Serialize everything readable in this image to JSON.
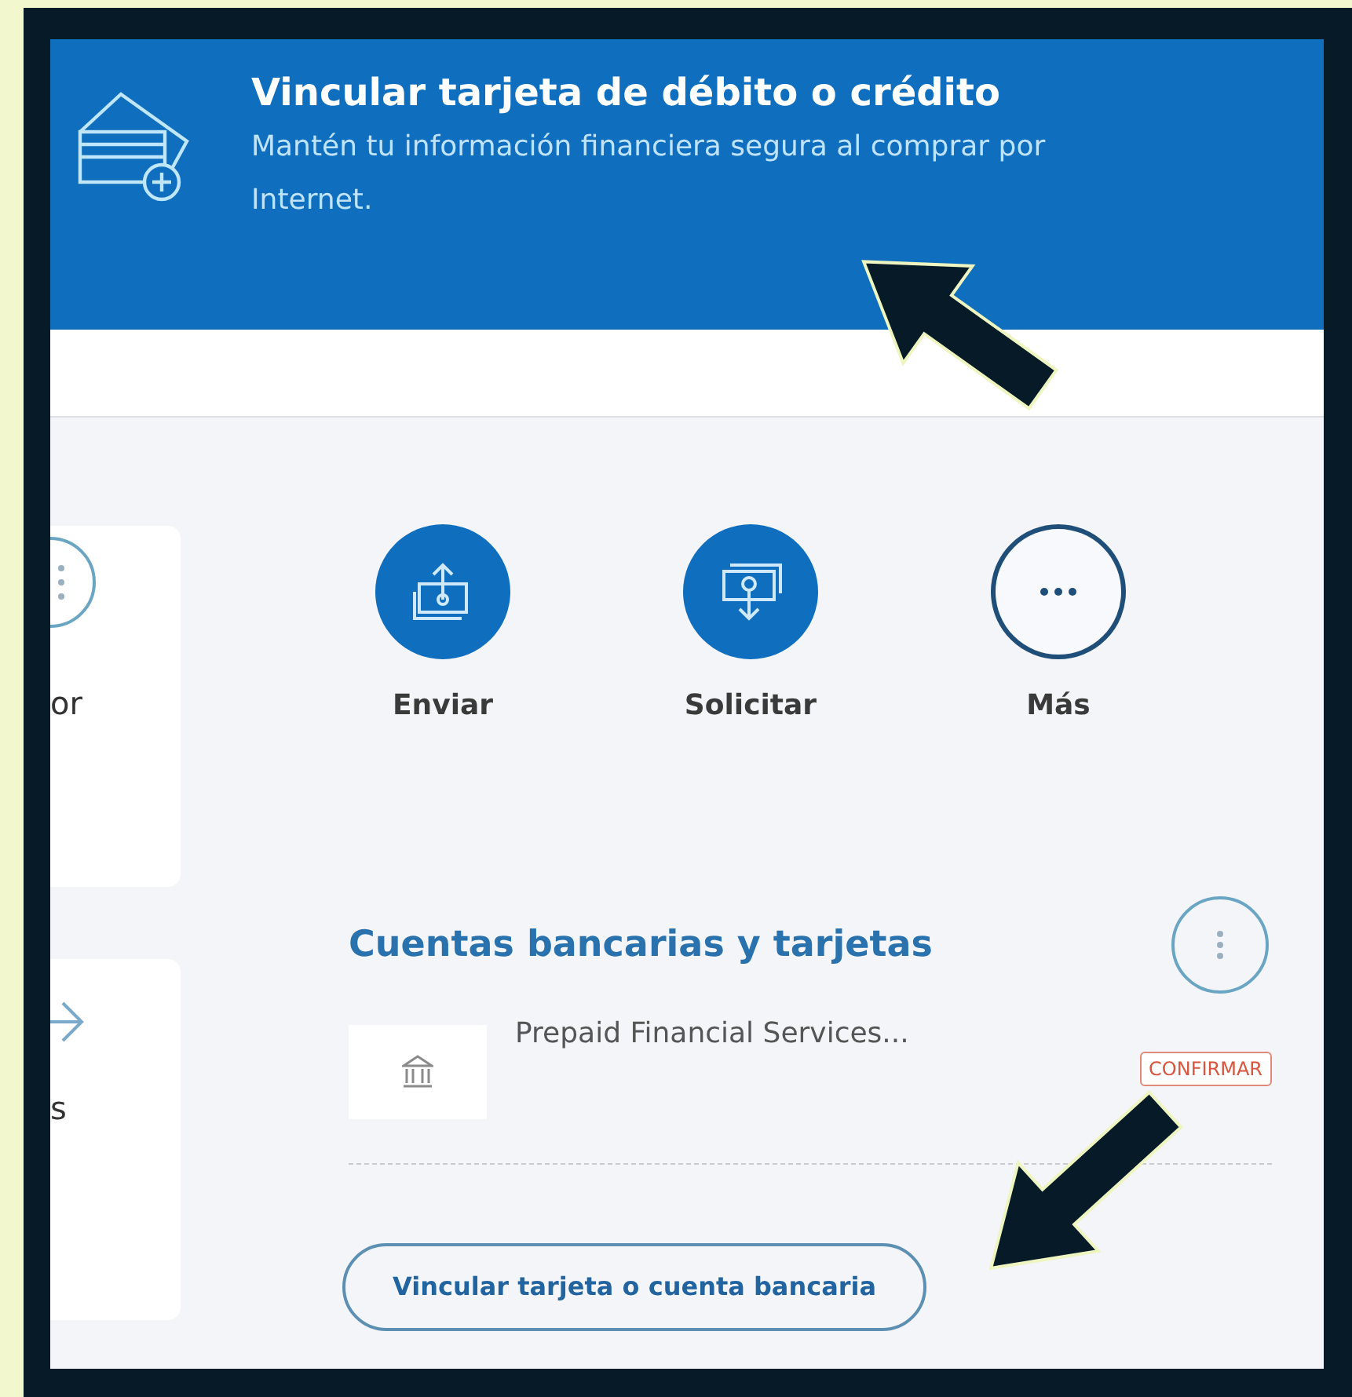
{
  "banner": {
    "title": "Vincular tarjeta de débito o crédito",
    "description": "Mantén tu información financiera segura al comprar por Internet."
  },
  "side_cards": [
    {
      "kind": "menu",
      "text": "or"
    },
    {
      "kind": "arrow",
      "text": "s"
    }
  ],
  "actions": [
    {
      "kind": "send",
      "label": "Enviar"
    },
    {
      "kind": "request",
      "label": "Solicitar"
    },
    {
      "kind": "more",
      "label": "Más"
    }
  ],
  "accounts": {
    "title": "Cuentas bancarias y tarjetas",
    "items": [
      {
        "name": "Prepaid Financial Services...",
        "badge": "CONFIRMAR"
      }
    ],
    "link_button": "Vincular tarjeta o cuenta bancaria"
  }
}
